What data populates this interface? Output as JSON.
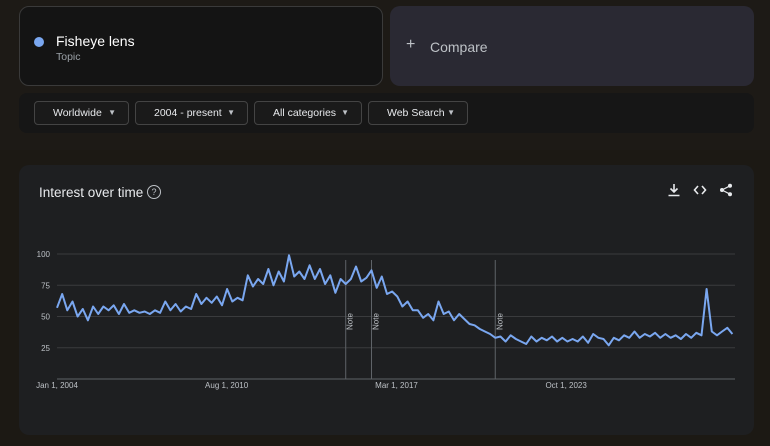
{
  "term": {
    "name": "Fisheye lens",
    "type": "Topic",
    "color": "#7aa7f0"
  },
  "compare": {
    "icon": "plus-icon",
    "label": "Compare"
  },
  "filters": {
    "region": "Worldwide",
    "time": "2004 - present",
    "category": "All categories",
    "search_type": "Web Search"
  },
  "chart_section": {
    "title": "Interest over time",
    "icons": [
      "help-icon",
      "download-icon",
      "embed-icon",
      "share-icon"
    ]
  },
  "chart_data": {
    "type": "line",
    "title": "",
    "xlabel": "",
    "ylabel": "",
    "x_start": "2004-01",
    "x_end": "2025-07",
    "x_tick_labels": [
      {
        "label": "Jan 1, 2004",
        "date": 2004.0
      },
      {
        "label": "Aug 1, 2010",
        "date": 2010.58
      },
      {
        "label": "Mar 1, 2017",
        "date": 2017.17
      },
      {
        "label": "Oct 1, 2023",
        "date": 2023.75
      }
    ],
    "y_ticks": [
      25,
      50,
      75,
      100
    ],
    "ylim": [
      0,
      100
    ],
    "grid": true,
    "notes": [
      {
        "label": "Note",
        "date": 2015.2
      },
      {
        "label": "Note",
        "date": 2016.2
      },
      {
        "label": "Note",
        "date": 2021.0
      }
    ],
    "series": [
      {
        "name": "Fisheye lens",
        "color": "#7aa7f0",
        "points": [
          [
            2004.0,
            57
          ],
          [
            2004.2,
            68
          ],
          [
            2004.4,
            55
          ],
          [
            2004.6,
            62
          ],
          [
            2004.8,
            50
          ],
          [
            2005.0,
            56
          ],
          [
            2005.2,
            47
          ],
          [
            2005.4,
            58
          ],
          [
            2005.6,
            52
          ],
          [
            2005.8,
            58
          ],
          [
            2006.0,
            55
          ],
          [
            2006.2,
            59
          ],
          [
            2006.4,
            52
          ],
          [
            2006.6,
            60
          ],
          [
            2006.8,
            53
          ],
          [
            2007.0,
            55
          ],
          [
            2007.2,
            53
          ],
          [
            2007.4,
            54
          ],
          [
            2007.6,
            52
          ],
          [
            2007.8,
            55
          ],
          [
            2008.0,
            53
          ],
          [
            2008.2,
            62
          ],
          [
            2008.4,
            55
          ],
          [
            2008.6,
            60
          ],
          [
            2008.8,
            54
          ],
          [
            2009.0,
            58
          ],
          [
            2009.2,
            56
          ],
          [
            2009.4,
            68
          ],
          [
            2009.6,
            60
          ],
          [
            2009.8,
            65
          ],
          [
            2010.0,
            61
          ],
          [
            2010.2,
            66
          ],
          [
            2010.4,
            59
          ],
          [
            2010.6,
            72
          ],
          [
            2010.8,
            62
          ],
          [
            2011.0,
            65
          ],
          [
            2011.2,
            63
          ],
          [
            2011.4,
            83
          ],
          [
            2011.6,
            74
          ],
          [
            2011.8,
            80
          ],
          [
            2012.0,
            76
          ],
          [
            2012.2,
            88
          ],
          [
            2012.4,
            75
          ],
          [
            2012.6,
            86
          ],
          [
            2012.8,
            78
          ],
          [
            2013.0,
            99
          ],
          [
            2013.2,
            82
          ],
          [
            2013.4,
            86
          ],
          [
            2013.6,
            80
          ],
          [
            2013.8,
            91
          ],
          [
            2014.0,
            80
          ],
          [
            2014.2,
            88
          ],
          [
            2014.4,
            76
          ],
          [
            2014.6,
            83
          ],
          [
            2014.8,
            69
          ],
          [
            2015.0,
            80
          ],
          [
            2015.2,
            76
          ],
          [
            2015.4,
            80
          ],
          [
            2015.6,
            90
          ],
          [
            2015.8,
            78
          ],
          [
            2016.0,
            81
          ],
          [
            2016.2,
            87
          ],
          [
            2016.4,
            73
          ],
          [
            2016.6,
            82
          ],
          [
            2016.8,
            68
          ],
          [
            2017.0,
            70
          ],
          [
            2017.2,
            66
          ],
          [
            2017.4,
            58
          ],
          [
            2017.6,
            62
          ],
          [
            2017.8,
            55
          ],
          [
            2018.0,
            55
          ],
          [
            2018.2,
            49
          ],
          [
            2018.4,
            52
          ],
          [
            2018.6,
            47
          ],
          [
            2018.8,
            62
          ],
          [
            2019.0,
            52
          ],
          [
            2019.2,
            54
          ],
          [
            2019.4,
            47
          ],
          [
            2019.6,
            52
          ],
          [
            2019.8,
            48
          ],
          [
            2020.0,
            44
          ],
          [
            2020.2,
            43
          ],
          [
            2020.4,
            40
          ],
          [
            2020.6,
            38
          ],
          [
            2020.8,
            36
          ],
          [
            2021.0,
            33
          ],
          [
            2021.2,
            34
          ],
          [
            2021.4,
            30
          ],
          [
            2021.6,
            35
          ],
          [
            2021.8,
            32
          ],
          [
            2022.0,
            30
          ],
          [
            2022.2,
            28
          ],
          [
            2022.4,
            34
          ],
          [
            2022.6,
            30
          ],
          [
            2022.8,
            33
          ],
          [
            2023.0,
            31
          ],
          [
            2023.2,
            34
          ],
          [
            2023.4,
            30
          ],
          [
            2023.6,
            33
          ],
          [
            2023.8,
            30
          ],
          [
            2024.0,
            32
          ],
          [
            2024.2,
            30
          ],
          [
            2024.4,
            34
          ],
          [
            2024.6,
            29
          ],
          [
            2024.8,
            36
          ],
          [
            2025.0,
            33
          ],
          [
            2025.2,
            32
          ],
          [
            2025.4,
            27
          ],
          [
            2025.6,
            33
          ],
          [
            2025.8,
            31
          ],
          [
            2026.0,
            35
          ],
          [
            2026.2,
            33
          ],
          [
            2026.4,
            38
          ],
          [
            2026.6,
            33
          ],
          [
            2026.8,
            36
          ],
          [
            2027.0,
            34
          ],
          [
            2027.2,
            37
          ],
          [
            2027.4,
            33
          ],
          [
            2027.6,
            36
          ],
          [
            2027.8,
            33
          ],
          [
            2028.0,
            35
          ],
          [
            2028.2,
            32
          ],
          [
            2028.4,
            36
          ],
          [
            2028.6,
            33
          ],
          [
            2028.8,
            37
          ],
          [
            2029.0,
            35
          ],
          [
            2029.2,
            72
          ],
          [
            2029.4,
            38
          ],
          [
            2029.6,
            35
          ],
          [
            2029.8,
            38
          ],
          [
            2030.0,
            41
          ],
          [
            2030.2,
            36
          ]
        ]
      }
    ]
  }
}
